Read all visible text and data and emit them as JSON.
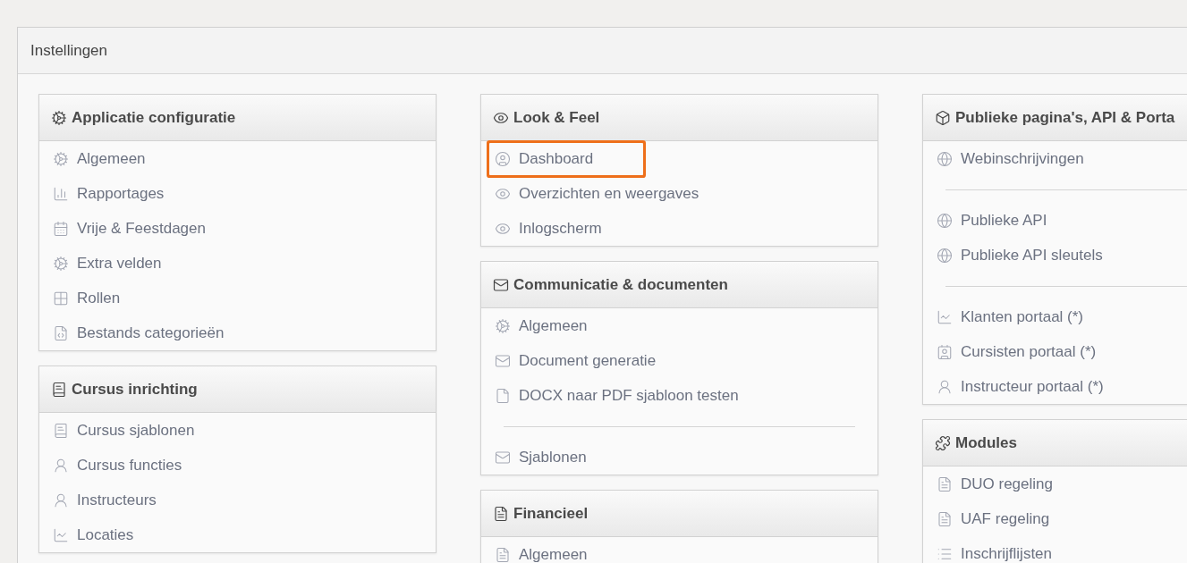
{
  "page": {
    "title": "Instellingen"
  },
  "columns": [
    {
      "panels": [
        {
          "title": "Applicatie configuratie",
          "items": [
            {
              "kind": "link",
              "label": "Algemeen",
              "highlighted": false
            },
            {
              "kind": "link",
              "label": "Rapportages",
              "highlighted": false
            },
            {
              "kind": "link",
              "label": "Vrije & Feestdagen",
              "highlighted": false
            },
            {
              "kind": "link",
              "label": "Extra velden",
              "highlighted": false
            },
            {
              "kind": "link",
              "label": "Rollen",
              "highlighted": false
            },
            {
              "kind": "link",
              "label": "Bestands categorieën",
              "highlighted": false
            }
          ]
        },
        {
          "title": "Cursus inrichting",
          "items": [
            {
              "kind": "link",
              "label": "Cursus sjablonen",
              "highlighted": false
            },
            {
              "kind": "link",
              "label": "Cursus functies",
              "highlighted": false
            },
            {
              "kind": "link",
              "label": "Instructeurs",
              "highlighted": false
            },
            {
              "kind": "link",
              "label": "Locaties",
              "highlighted": false
            }
          ]
        }
      ]
    },
    {
      "panels": [
        {
          "title": "Look & Feel",
          "items": [
            {
              "kind": "link",
              "label": "Dashboard",
              "highlighted": true
            },
            {
              "kind": "link",
              "label": "Overzichten en weergaves",
              "highlighted": false
            },
            {
              "kind": "link",
              "label": "Inlogscherm",
              "highlighted": false
            }
          ]
        },
        {
          "title": "Communicatie & documenten",
          "items": [
            {
              "kind": "link",
              "label": "Algemeen",
              "highlighted": false
            },
            {
              "kind": "link",
              "label": "Document generatie",
              "highlighted": false
            },
            {
              "kind": "link",
              "label": "DOCX naar PDF sjabloon testen",
              "highlighted": false
            },
            {
              "kind": "divider"
            },
            {
              "kind": "link",
              "label": "Sjablonen",
              "highlighted": false
            }
          ]
        },
        {
          "title": "Financieel",
          "items": [
            {
              "kind": "link",
              "label": "Algemeen",
              "highlighted": false
            }
          ]
        }
      ]
    },
    {
      "panels": [
        {
          "title": "Publieke pagina's, API & Porta",
          "items": [
            {
              "kind": "link",
              "label": "Webinschrijvingen",
              "highlighted": false
            },
            {
              "kind": "divider"
            },
            {
              "kind": "link",
              "label": "Publieke API",
              "highlighted": false
            },
            {
              "kind": "link",
              "label": "Publieke API sleutels",
              "highlighted": false
            },
            {
              "kind": "divider"
            },
            {
              "kind": "link",
              "label": "Klanten portaal (*)",
              "highlighted": false
            },
            {
              "kind": "link",
              "label": "Cursisten portaal (*)",
              "highlighted": false
            },
            {
              "kind": "link",
              "label": "Instructeur portaal (*)",
              "highlighted": false
            }
          ]
        },
        {
          "title": "Modules",
          "items": [
            {
              "kind": "link",
              "label": "DUO regeling",
              "highlighted": false
            },
            {
              "kind": "link",
              "label": "UAF regeling",
              "highlighted": false
            },
            {
              "kind": "link",
              "label": "Inschrijflijsten",
              "highlighted": false
            }
          ]
        }
      ]
    }
  ]
}
